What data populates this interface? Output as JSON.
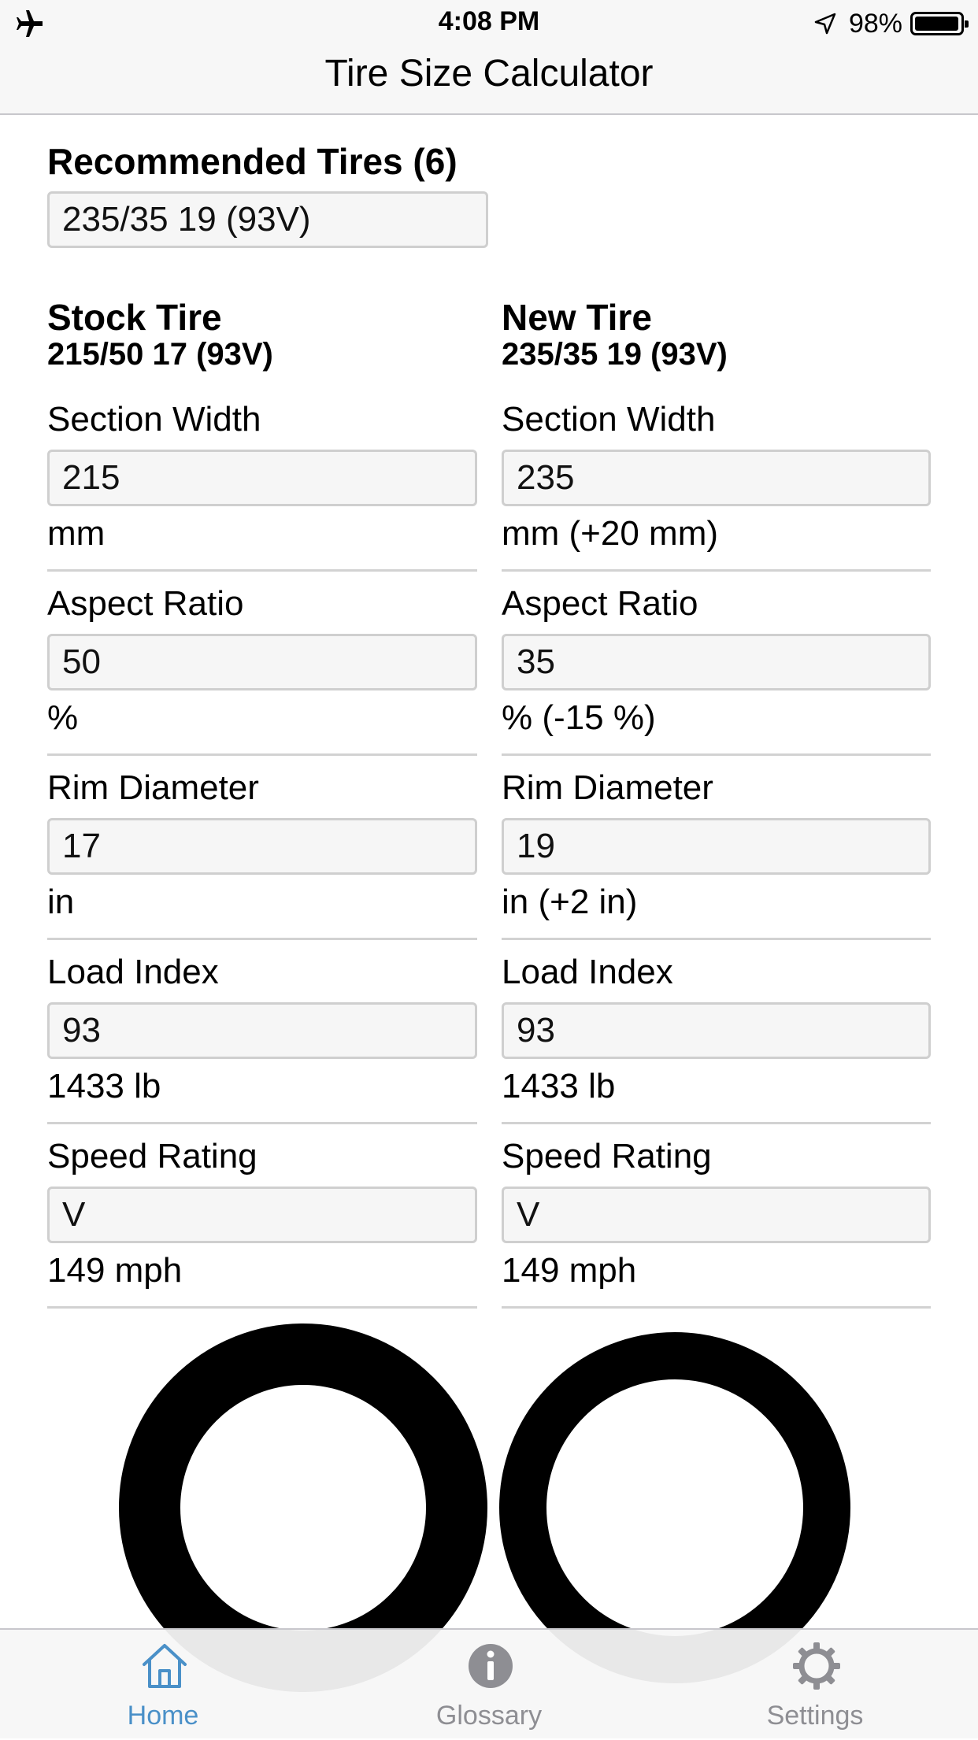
{
  "status_bar": {
    "time": "4:08 PM",
    "battery_text": "98%",
    "battery_level": 0.98
  },
  "nav": {
    "title": "Tire Size Calculator"
  },
  "recommended": {
    "title": "Recommended Tires (6)",
    "selected": "235/35 19 (93V)"
  },
  "stock": {
    "heading": "Stock Tire",
    "size": "215/50 17 (93V)",
    "rows": [
      {
        "label": "Section Width",
        "value": "215",
        "unit": "mm"
      },
      {
        "label": "Aspect Ratio",
        "value": "50",
        "unit": "%"
      },
      {
        "label": "Rim Diameter",
        "value": "17",
        "unit": "in"
      },
      {
        "label": "Load Index",
        "value": "93",
        "unit": "1433 lb"
      },
      {
        "label": "Speed Rating",
        "value": "V",
        "unit": "149 mph"
      }
    ]
  },
  "new": {
    "heading": "New Tire",
    "size": "235/35 19 (93V)",
    "rows": [
      {
        "label": "Section Width",
        "value": "235",
        "unit": "mm (+20 mm)"
      },
      {
        "label": "Aspect Ratio",
        "value": "35",
        "unit": "% (-15 %)"
      },
      {
        "label": "Rim Diameter",
        "value": "19",
        "unit": "in (+2 in)"
      },
      {
        "label": "Load Index",
        "value": "93",
        "unit": "1433 lb"
      },
      {
        "label": "Speed Rating",
        "value": "V",
        "unit": "149 mph"
      }
    ]
  },
  "tabs": [
    {
      "label": "Home",
      "icon": "home-icon",
      "active": true
    },
    {
      "label": "Glossary",
      "icon": "info-icon",
      "active": false
    },
    {
      "label": "Settings",
      "icon": "gear-icon",
      "active": false
    }
  ],
  "colors": {
    "accent": "#4a90c8",
    "inactive_tab": "#8e8e93",
    "tire": "#000000"
  }
}
